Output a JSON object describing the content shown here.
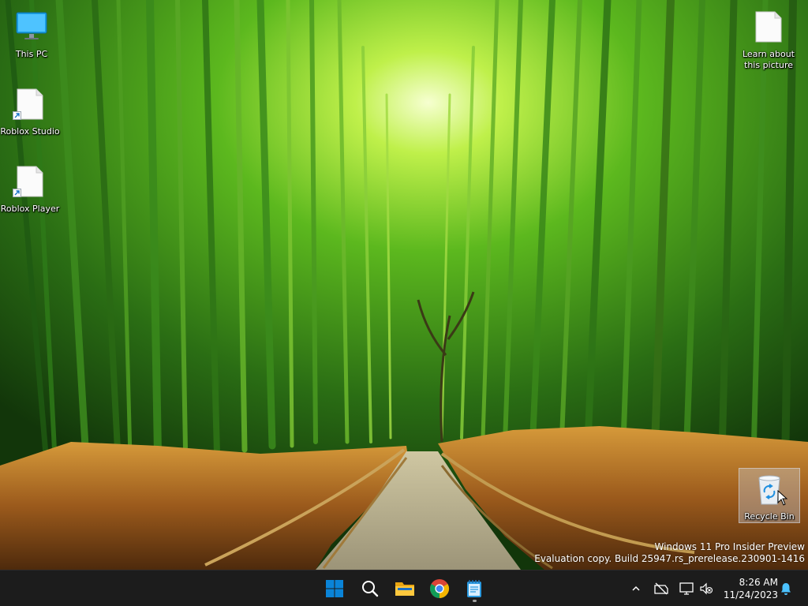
{
  "desktop": {
    "icons": [
      {
        "label": "This PC",
        "icon": "monitor-icon"
      },
      {
        "label": "Roblox Studio",
        "icon": "blank-file-icon"
      },
      {
        "label": "Roblox Player",
        "icon": "blank-file-icon"
      },
      {
        "label": "Learn about this picture",
        "icon": "blank-file-icon"
      },
      {
        "label": "Recycle Bin",
        "icon": "recycle-bin-icon"
      }
    ]
  },
  "watermark": {
    "line1": "Windows 11 Pro Insider Preview",
    "line2": "Evaluation copy. Build 25947.rs_prerelease.230901-1416"
  },
  "taskbar": {
    "apps": [
      {
        "name": "start",
        "icon": "windows-logo-icon"
      },
      {
        "name": "search",
        "icon": "search-icon"
      },
      {
        "name": "file-explorer",
        "icon": "folder-icon"
      },
      {
        "name": "chrome",
        "icon": "chrome-icon"
      },
      {
        "name": "notepad",
        "icon": "notepad-icon",
        "running": true
      }
    ],
    "tray": {
      "icons": [
        "chevron-up-icon",
        "network-offline-icon",
        "display-icon",
        "volume-muted-icon",
        "notification-bell-icon"
      ]
    },
    "clock": {
      "time": "8:26 AM",
      "date": "11/24/2023"
    }
  },
  "colors": {
    "taskbar_bg": "#1c1c1c",
    "start_blue": "#0a84d8",
    "bell_blue": "#4cc2ff"
  }
}
